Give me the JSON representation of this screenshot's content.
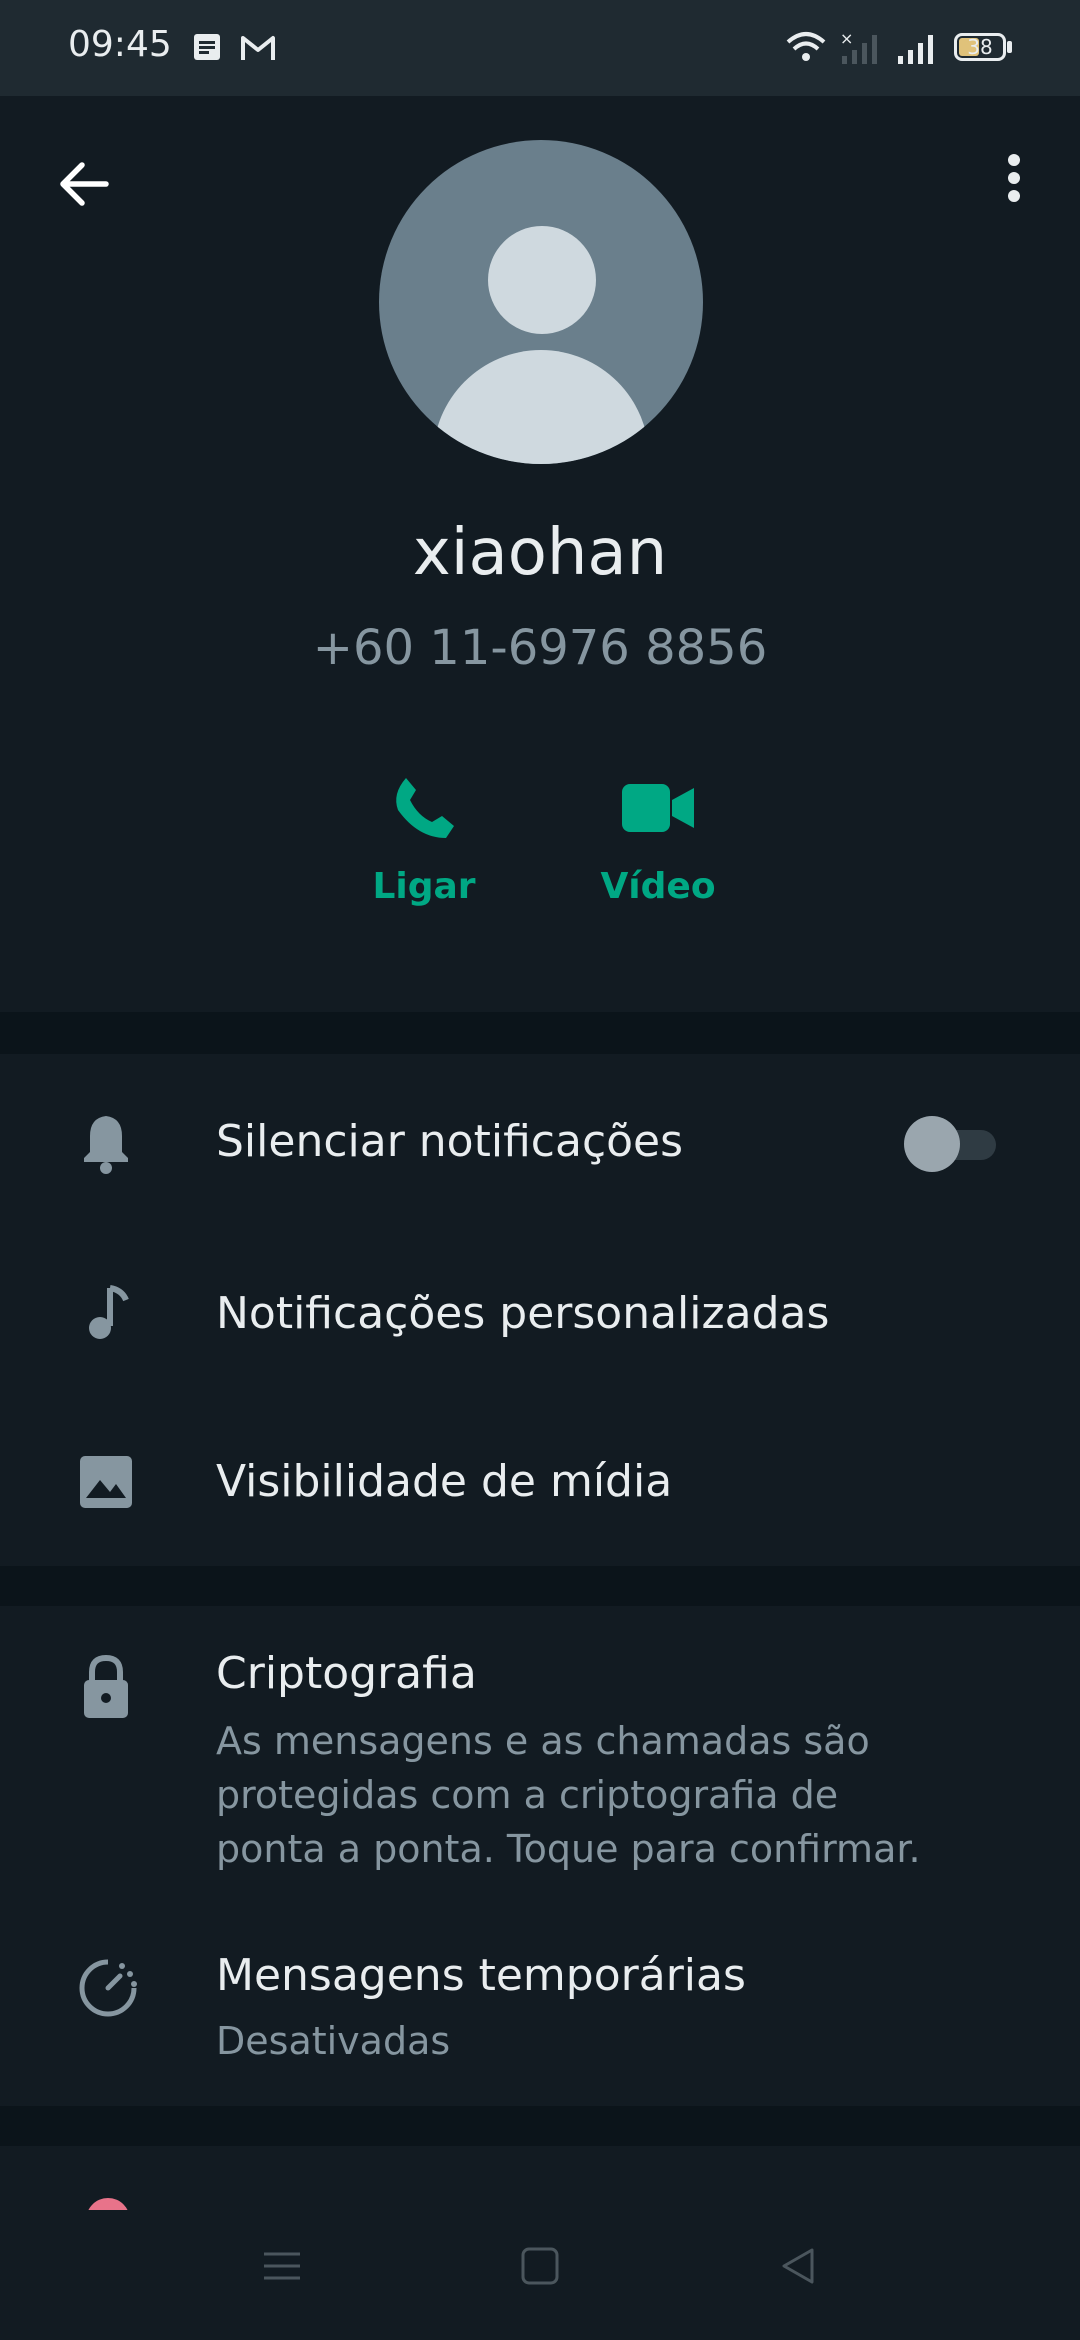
{
  "status_bar": {
    "time": "09:45",
    "battery": "38",
    "icons": [
      "notes-icon",
      "gmail-icon",
      "wifi-icon",
      "no-signal-icon",
      "signal-icon",
      "battery-icon"
    ]
  },
  "contact": {
    "name": "xiaohan",
    "phone": "+60 11-6976 8856"
  },
  "actions": [
    {
      "label": "Ligar",
      "icon": "phone-icon"
    },
    {
      "label": "Vídeo",
      "icon": "video-icon"
    }
  ],
  "settings": {
    "mute": {
      "title": "Silenciar notificações",
      "enabled": false
    },
    "custom_notifications": {
      "title": "Notificações personalizadas"
    },
    "media_visibility": {
      "title": "Visibilidade de mídia"
    },
    "encryption": {
      "title": "Criptografia",
      "line1": "As mensagens e as chamadas são",
      "line2": "protegidas com a criptografia de",
      "line3": "ponta a ponta. Toque para confirmar."
    },
    "disappearing": {
      "title": "Mensagens temporárias",
      "subtitle": "Desativadas"
    }
  },
  "colors": {
    "background": "#121b22",
    "accent": "#00a884",
    "secondary_text": "#8696a0"
  }
}
